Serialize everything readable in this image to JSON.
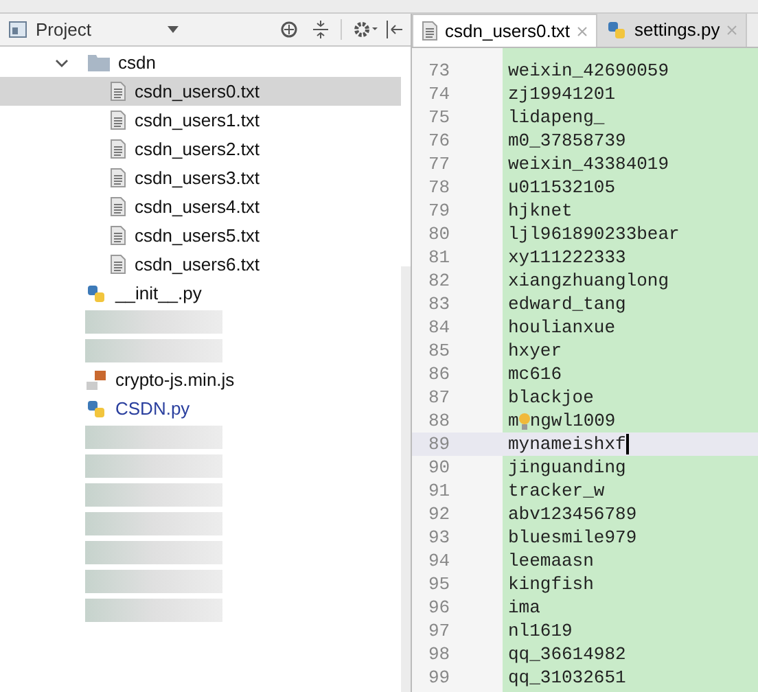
{
  "project_panel": {
    "title": "Project",
    "tree": [
      {
        "label": "csdn",
        "kind": "folder",
        "expanded": true,
        "children": [
          {
            "label": "csdn_users0.txt",
            "kind": "text",
            "selected": true
          },
          {
            "label": "csdn_users1.txt",
            "kind": "text",
            "selected": false
          },
          {
            "label": "csdn_users2.txt",
            "kind": "text",
            "selected": false
          },
          {
            "label": "csdn_users3.txt",
            "kind": "text",
            "selected": false
          },
          {
            "label": "csdn_users4.txt",
            "kind": "text",
            "selected": false
          },
          {
            "label": "csdn_users5.txt",
            "kind": "text",
            "selected": false
          },
          {
            "label": "csdn_users6.txt",
            "kind": "text",
            "selected": false
          }
        ]
      },
      {
        "label": "__init__.py",
        "kind": "python",
        "selected": false
      },
      {
        "kind": "blurred"
      },
      {
        "kind": "blurred"
      },
      {
        "label": "crypto-js.min.js",
        "kind": "js",
        "selected": false
      },
      {
        "label": "CSDN.py",
        "kind": "python",
        "selected": false,
        "modified": true
      },
      {
        "kind": "blurred"
      },
      {
        "kind": "blurred"
      },
      {
        "kind": "blurred"
      },
      {
        "kind": "blurred"
      },
      {
        "kind": "blurred"
      },
      {
        "kind": "blurred"
      },
      {
        "kind": "blurred"
      }
    ]
  },
  "editor": {
    "tabs": [
      {
        "label": "csdn_users0.txt",
        "kind": "text",
        "selected": true
      },
      {
        "label": "settings.py",
        "kind": "python",
        "selected": false
      }
    ],
    "lines": [
      {
        "number": "73",
        "text": "weixin_42690059"
      },
      {
        "number": "74",
        "text": "zj19941201"
      },
      {
        "number": "75",
        "text": "lidapeng_"
      },
      {
        "number": "76",
        "text": "m0_37858739"
      },
      {
        "number": "77",
        "text": "weixin_43384019"
      },
      {
        "number": "78",
        "text": "u011532105"
      },
      {
        "number": "79",
        "text": "hjknet"
      },
      {
        "number": "80",
        "text": "ljl961890233bear"
      },
      {
        "number": "81",
        "text": "xy111222333"
      },
      {
        "number": "82",
        "text": "xiangzhuanglong"
      },
      {
        "number": "83",
        "text": "edward_tang"
      },
      {
        "number": "84",
        "text": "houlianxue"
      },
      {
        "number": "85",
        "text": "hxyer"
      },
      {
        "number": "86",
        "text": "mc616"
      },
      {
        "number": "87",
        "text": "blackjoe"
      },
      {
        "number": "88",
        "text": "m",
        "text_after": "ngwl1009",
        "hint": true
      },
      {
        "number": "89",
        "text": "mynameishxf",
        "current": true
      },
      {
        "number": "90",
        "text": "jinguanding"
      },
      {
        "number": "91",
        "text": "tracker_w"
      },
      {
        "number": "92",
        "text": "abv123456789"
      },
      {
        "number": "93",
        "text": "bluesmile979"
      },
      {
        "number": "94",
        "text": "leemaasn"
      },
      {
        "number": "95",
        "text": "kingfish"
      },
      {
        "number": "96",
        "text": "ima"
      },
      {
        "number": "97",
        "text": "nl1619"
      },
      {
        "number": "98",
        "text": "qq_36614982"
      },
      {
        "number": "99",
        "text": "qq_31032651"
      }
    ]
  }
}
